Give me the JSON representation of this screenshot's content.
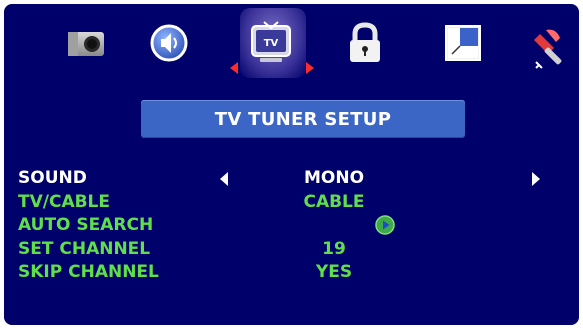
{
  "toolbar": {
    "icons": [
      "camera-icon",
      "audio-icon",
      "tv-icon",
      "lock-icon",
      "pip-icon",
      "tools-icon"
    ],
    "selected": "tv-icon"
  },
  "title": "TV TUNER SETUP",
  "menu": [
    {
      "label": "SOUND",
      "value": "MONO"
    },
    {
      "label": "TV/CABLE",
      "value": "CABLE"
    },
    {
      "label": "AUTO SEARCH",
      "value": ""
    },
    {
      "label": "SET CHANNEL",
      "value": "19"
    },
    {
      "label": "SKIP CHANNEL",
      "value": "YES"
    }
  ],
  "colors": {
    "background": "#00006a",
    "title_bar": "#3c66c6",
    "selected_text": "#ffffff",
    "item_text": "#5fe04a",
    "indicator_arrows": "#ff2a2a"
  }
}
